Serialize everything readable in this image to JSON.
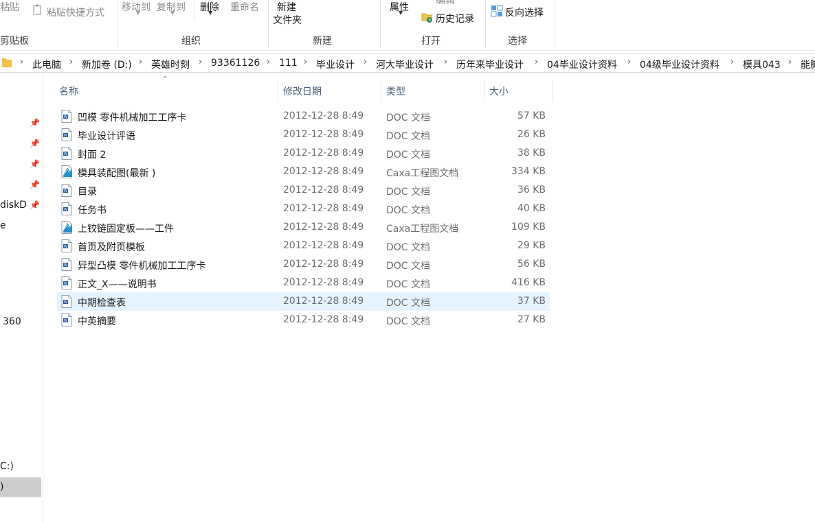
{
  "ribbon": {
    "clipboard": {
      "paste": "粘贴",
      "paste_shortcut": "粘贴快捷方式",
      "group_label": "剪贴板"
    },
    "organize": {
      "move_to": "移动到",
      "copy_to": "复制到",
      "delete": "删除",
      "rename": "重命名",
      "group_label": "组织"
    },
    "new": {
      "new_folder_line1": "新建",
      "new_folder_line2": "文件夹",
      "group_label": "新建"
    },
    "open": {
      "properties": "属性",
      "edit": "编辑",
      "history": "历史记录",
      "group_label": "打开"
    },
    "select": {
      "invert": "反向选择",
      "group_label": "选择"
    }
  },
  "breadcrumb": [
    "此电脑",
    "新加卷 (D:)",
    "英雄时刻",
    "93361126",
    "111",
    "毕业设计",
    "河大毕业设计",
    "历年来毕业设计",
    "04毕业设计资料",
    "04级毕业设计资料",
    "模具043",
    "能脚"
  ],
  "nav": {
    "item_disk": "diskDc",
    "item_e": "e",
    "item_360": "360",
    "item_c": "C:)",
    "item_sel": ")"
  },
  "columns": {
    "name": "名称",
    "date": "修改日期",
    "type": "类型",
    "size": "大小"
  },
  "files": [
    {
      "name": "凹模  零件机械加工工序卡",
      "date": "2012-12-28 8:49",
      "type": "DOC 文档",
      "size": "57 KB",
      "icon": "doc-icon"
    },
    {
      "name": "毕业设计评语",
      "date": "2012-12-28 8:49",
      "type": "DOC 文档",
      "size": "26 KB",
      "icon": "doc-icon"
    },
    {
      "name": "封面 2",
      "date": "2012-12-28 8:49",
      "type": "DOC 文档",
      "size": "38 KB",
      "icon": "doc-icon"
    },
    {
      "name": "模具装配图(最新 )",
      "date": "2012-12-28 8:49",
      "type": "Caxa工程图文档",
      "size": "334 KB",
      "icon": "caxa-icon"
    },
    {
      "name": "目录",
      "date": "2012-12-28 8:49",
      "type": "DOC 文档",
      "size": "36 KB",
      "icon": "doc-icon"
    },
    {
      "name": "任务书",
      "date": "2012-12-28 8:49",
      "type": "DOC 文档",
      "size": "40 KB",
      "icon": "doc-icon"
    },
    {
      "name": "上铰链固定板——工件",
      "date": "2012-12-28 8:49",
      "type": "Caxa工程图文档",
      "size": "109 KB",
      "icon": "caxa-icon"
    },
    {
      "name": "首页及附页模板",
      "date": "2012-12-28 8:49",
      "type": "DOC 文档",
      "size": "29 KB",
      "icon": "doc-icon"
    },
    {
      "name": "异型凸模  零件机械加工工序卡",
      "date": "2012-12-28 8:49",
      "type": "DOC 文档",
      "size": "56 KB",
      "icon": "doc-icon"
    },
    {
      "name": "正文_X——说明书",
      "date": "2012-12-28 8:49",
      "type": "DOC 文档",
      "size": "416 KB",
      "icon": "doc-icon"
    },
    {
      "name": "中期检查表",
      "date": "2012-12-28 8:49",
      "type": "DOC 文档",
      "size": "37 KB",
      "icon": "doc-icon",
      "selected": true
    },
    {
      "name": "中英摘要",
      "date": "2012-12-28 8:49",
      "type": "DOC 文档",
      "size": "27 KB",
      "icon": "doc-icon"
    }
  ],
  "colors": {
    "selection": "#e5f3ff",
    "header_text": "#4c607a",
    "nav_selected": "#cccccc"
  }
}
